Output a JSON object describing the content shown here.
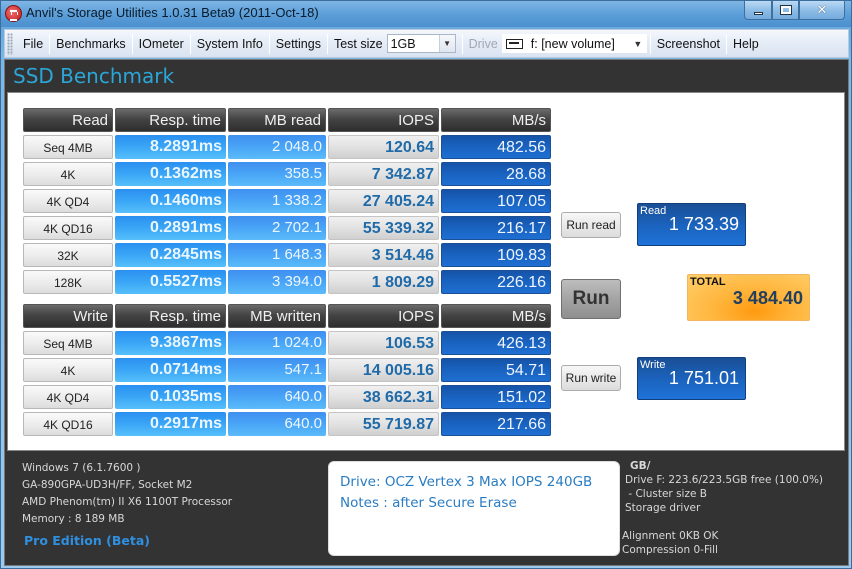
{
  "window": {
    "title": "Anvil's Storage Utilities 1.0.31 Beta9 (2011-Oct-18)",
    "close_glyph": "✕"
  },
  "menubar": {
    "items": [
      "File",
      "Benchmarks",
      "IOmeter",
      "System Info",
      "Settings"
    ],
    "test_size_label": "Test size",
    "test_size_value": "1GB",
    "drive_label": "Drive",
    "drive_value": "f: [new volume]",
    "screenshot": "Screenshot",
    "help": "Help"
  },
  "header": {
    "title": "SSD Benchmark"
  },
  "read_table": {
    "headers": [
      "Read",
      "Resp. time",
      "MB read",
      "IOPS",
      "MB/s"
    ],
    "rows": [
      {
        "label": "Seq 4MB",
        "resp": "8.2891ms",
        "mb": "2 048.0",
        "iops": "120.64",
        "mbs": "482.56"
      },
      {
        "label": "4K",
        "resp": "0.1362ms",
        "mb": "358.5",
        "iops": "7 342.87",
        "mbs": "28.68"
      },
      {
        "label": "4K QD4",
        "resp": "0.1460ms",
        "mb": "1 338.2",
        "iops": "27 405.24",
        "mbs": "107.05"
      },
      {
        "label": "4K QD16",
        "resp": "0.2891ms",
        "mb": "2 702.1",
        "iops": "55 339.32",
        "mbs": "216.17"
      },
      {
        "label": "32K",
        "resp": "0.2845ms",
        "mb": "1 648.3",
        "iops": "3 514.46",
        "mbs": "109.83"
      },
      {
        "label": "128K",
        "resp": "0.5527ms",
        "mb": "3 394.0",
        "iops": "1 809.29",
        "mbs": "226.16"
      }
    ]
  },
  "write_table": {
    "headers": [
      "Write",
      "Resp. time",
      "MB written",
      "IOPS",
      "MB/s"
    ],
    "rows": [
      {
        "label": "Seq 4MB",
        "resp": "9.3867ms",
        "mb": "1 024.0",
        "iops": "106.53",
        "mbs": "426.13"
      },
      {
        "label": "4K",
        "resp": "0.0714ms",
        "mb": "547.1",
        "iops": "14 005.16",
        "mbs": "54.71"
      },
      {
        "label": "4K QD4",
        "resp": "0.1035ms",
        "mb": "640.0",
        "iops": "38 662.31",
        "mbs": "151.02"
      },
      {
        "label": "4K QD16",
        "resp": "0.2917ms",
        "mb": "640.0",
        "iops": "55 719.87",
        "mbs": "217.66"
      }
    ]
  },
  "buttons": {
    "run_read": "Run read",
    "run": "Run",
    "run_write": "Run write"
  },
  "scores": {
    "read_label": "Read",
    "read_value": "1 733.39",
    "total_label": "TOTAL",
    "total_value": "3 484.40",
    "write_label": "Write",
    "write_value": "1 751.01"
  },
  "system_info": {
    "lines": [
      "Windows 7 (6.1.7600 )",
      "GA-890GPA-UD3H/FF, Socket M2",
      "AMD Phenom(tm) II X6 1100T Processor",
      "Memory : 8 189 MB"
    ],
    "edition": "Pro Edition (Beta)"
  },
  "notes": {
    "drive_line": "Drive: OCZ Vertex 3 Max IOPS 240GB",
    "notes_line": "Notes : after Secure Erase"
  },
  "drive_info": {
    "heading": "GB/",
    "lines": [
      "Drive F: 223.6/223.5GB free (100.0%)",
      " - Cluster size B",
      "Storage driver",
      "",
      "Alignment 0KB OK",
      "Compression 0-Fill"
    ]
  }
}
